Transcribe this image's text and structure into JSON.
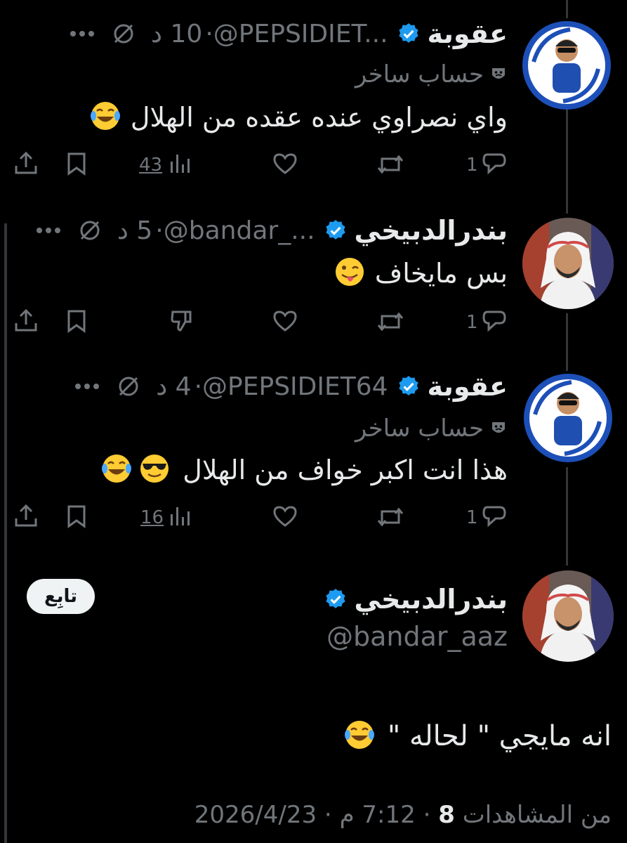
{
  "replies": [
    {
      "display_name": "عقوبة",
      "handle": "@PEPSIDIET...",
      "time": "10 د",
      "badge_label": "حساب ساخر",
      "text": "واي نصراوي عنده عقده من الهلال",
      "emoji": "joy",
      "actions": {
        "replies": "1",
        "retweets": "",
        "likes": "",
        "views": "43"
      }
    },
    {
      "display_name": "بندرالدبيخي",
      "handle": "@bandar_...",
      "time": "5 د",
      "text": "بس مايخاف",
      "emoji": "winking-tongue",
      "actions": {
        "replies": "1",
        "retweets": "",
        "likes": ""
      }
    },
    {
      "display_name": "عقوبة",
      "handle": "@PEPSIDIET64",
      "time": "4 د",
      "badge_label": "حساب ساخر",
      "text": "هذا انت اكبر خواف من الهلال",
      "emoji": "sunglasses-joy",
      "actions": {
        "replies": "1",
        "retweets": "",
        "likes": "",
        "views": "16"
      }
    }
  ],
  "main_post": {
    "display_name": "بندرالدبيخي",
    "handle": "@bandar_aaz",
    "follow_label": "تابِع",
    "text": "انه مايجي \" لحاله \"",
    "emoji": "joy"
  },
  "footer": {
    "date": "2026/4/23",
    "time": "7:12 م",
    "views_count": "8",
    "views_label": "من المشاهدات"
  },
  "colors": {
    "background": "#000000",
    "text": "#e7e9ea",
    "muted": "#71767b",
    "verified": "#1d9bf0",
    "avatar_ring": "#1d4fb8"
  }
}
